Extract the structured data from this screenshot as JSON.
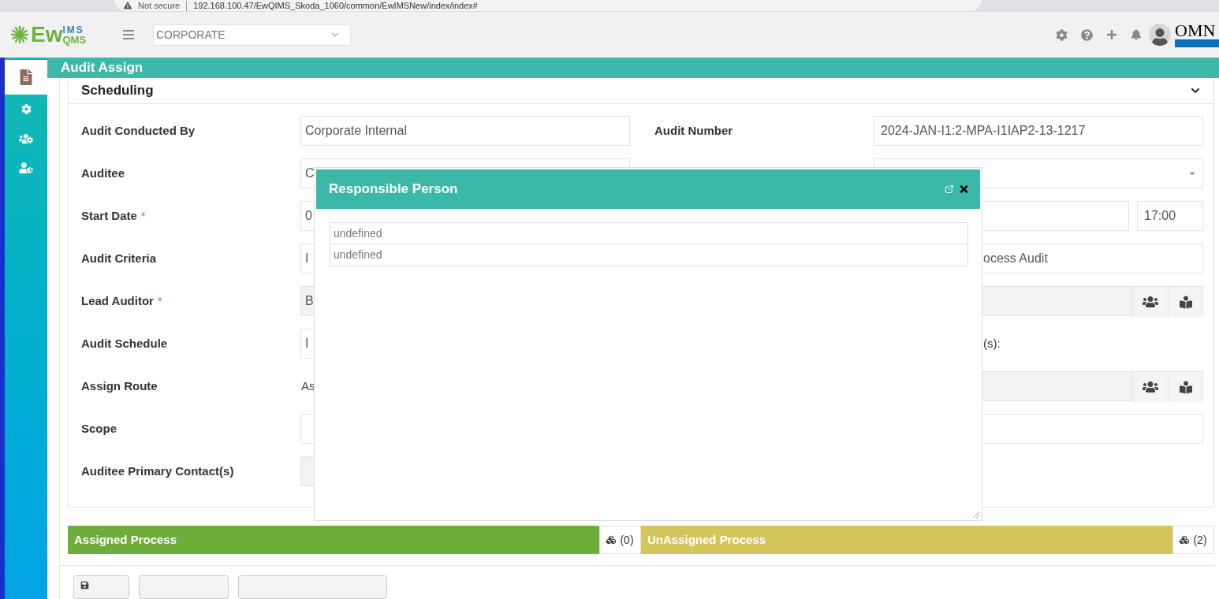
{
  "browser": {
    "security": "Not secure",
    "url": "192.168.100.47/EwQIMS_Skoda_1060/common/EwIMSNew/index/index#"
  },
  "header": {
    "logo": {
      "main": "Ew",
      "upper": "IMS",
      "lower": "QMS"
    },
    "unit_select": "CORPORATE",
    "brand": "OMN"
  },
  "sidebar": {
    "items": [
      {
        "kind": "document",
        "selected": true
      },
      {
        "kind": "gear",
        "selected": false
      },
      {
        "kind": "group",
        "selected": false
      },
      {
        "kind": "user-shield",
        "selected": false
      }
    ]
  },
  "page_title": "Audit Assign",
  "section": {
    "title": "Scheduling",
    "expanded": true
  },
  "rows": [
    {
      "label": "Audit Conducted By",
      "left": {
        "kind": "input",
        "value": "Corporate Internal"
      },
      "right": {
        "kind": "input",
        "label": "Audit Number",
        "value": "2024-JAN-I1:2-MPA-I1IAP2-13-1217"
      }
    },
    {
      "label": "Auditee",
      "left": {
        "kind": "input",
        "value": "C"
      },
      "right": {
        "kind": "select"
      }
    },
    {
      "label": "Start Date",
      "required_mark": "*",
      "left": {
        "kind": "input",
        "value": "0"
      },
      "right": {
        "kind": "datetime",
        "time": "17:00"
      }
    },
    {
      "label": "Audit Criteria",
      "left": {
        "kind": "input",
        "value": "I"
      },
      "right": {
        "kind": "input_fragment",
        "value": "ocess Audit"
      }
    },
    {
      "label": "Lead Auditor",
      "required_mark": "*",
      "left": {
        "kind": "readonly",
        "value": "B"
      },
      "right": {
        "kind": "picker"
      }
    },
    {
      "label": "Audit Schedule",
      "left": {
        "kind": "input",
        "value": "I"
      },
      "right": {
        "kind": "label_fragment",
        "label": "(s):"
      }
    },
    {
      "label": "Assign Route",
      "left": {
        "kind": "text",
        "value": "As"
      },
      "right": {
        "kind": "picker"
      }
    },
    {
      "label": "Scope",
      "left": {
        "kind": "input"
      },
      "right": {
        "kind": "input_fragment"
      }
    },
    {
      "label": "Auditee Primary Contact(s)",
      "left": {
        "kind": "readonly"
      },
      "right": {
        "kind": "none"
      }
    }
  ],
  "process_bars": [
    {
      "label": "Assigned Process",
      "count": "(0)",
      "color": "#6dad3a"
    },
    {
      "label": "UnAssigned Process",
      "count": "(2)",
      "color": "#d4c65a"
    }
  ],
  "modal": {
    "title": "Responsible Person",
    "items": [
      "undefined",
      "undefined"
    ]
  }
}
